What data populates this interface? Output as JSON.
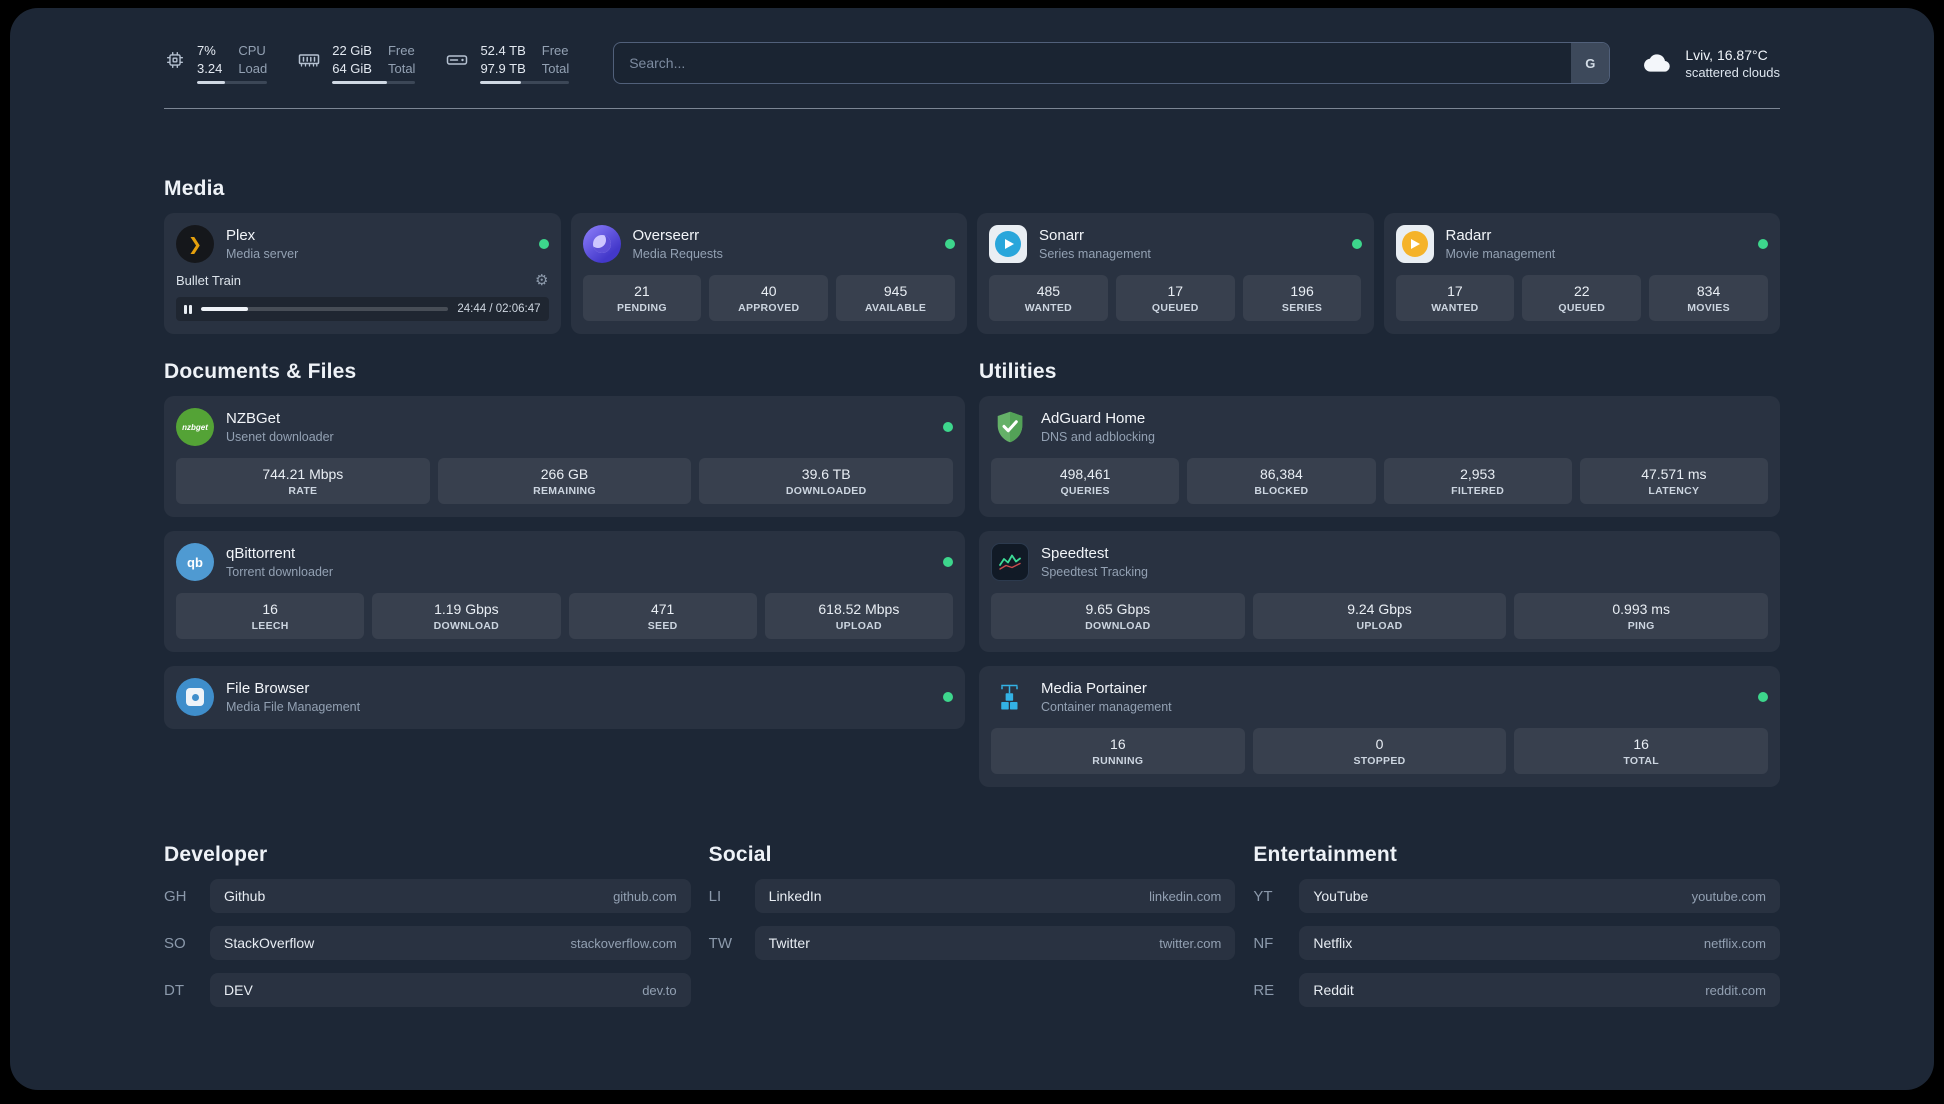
{
  "icons": {
    "plex_chevron": "❯",
    "gear": "⚙",
    "nzbget_label": "nzbget",
    "qbittorrent_label": "qb"
  },
  "colors": {
    "status_online": "#3dd68c",
    "portainer_blue": "#33b2e5"
  },
  "topbar": {
    "cpu": {
      "value_top": "7%",
      "value_bottom": "3.24",
      "label_top": "CPU",
      "label_bottom": "Load",
      "bar_percent": 40
    },
    "memory": {
      "value_top": "22 GiB",
      "value_bottom": "64 GiB",
      "label_top": "Free",
      "label_bottom": "Total",
      "bar_percent": 66
    },
    "disk": {
      "value_top": "52.4 TB",
      "value_bottom": "97.9 TB",
      "label_top": "Free",
      "label_bottom": "Total",
      "bar_percent": 46
    },
    "search": {
      "placeholder": "Search...",
      "provider_button": "G"
    },
    "weather": {
      "location": "Lviv, 16.87°C",
      "condition": "scattered clouds"
    }
  },
  "media": {
    "heading": "Media",
    "plex": {
      "title": "Plex",
      "subtitle": "Media server",
      "now_playing": "Bullet Train",
      "progress_percent": 19,
      "time": "24:44 / 02:06:47"
    },
    "overseerr": {
      "title": "Overseerr",
      "subtitle": "Media Requests",
      "stats": [
        {
          "value": "21",
          "label": "PENDING"
        },
        {
          "value": "40",
          "label": "APPROVED"
        },
        {
          "value": "945",
          "label": "AVAILABLE"
        }
      ]
    },
    "sonarr": {
      "title": "Sonarr",
      "subtitle": "Series management",
      "stats": [
        {
          "value": "485",
          "label": "WANTED"
        },
        {
          "value": "17",
          "label": "QUEUED"
        },
        {
          "value": "196",
          "label": "SERIES"
        }
      ]
    },
    "radarr": {
      "title": "Radarr",
      "subtitle": "Movie management",
      "stats": [
        {
          "value": "17",
          "label": "WANTED"
        },
        {
          "value": "22",
          "label": "QUEUED"
        },
        {
          "value": "834",
          "label": "MOVIES"
        }
      ]
    }
  },
  "documents": {
    "heading": "Documents & Files",
    "nzbget": {
      "title": "NZBGet",
      "subtitle": "Usenet downloader",
      "stats": [
        {
          "value": "744.21 Mbps",
          "label": "RATE"
        },
        {
          "value": "266 GB",
          "label": "REMAINING"
        },
        {
          "value": "39.6 TB",
          "label": "DOWNLOADED"
        }
      ]
    },
    "qbittorrent": {
      "title": "qBittorrent",
      "subtitle": "Torrent downloader",
      "stats": [
        {
          "value": "16",
          "label": "LEECH"
        },
        {
          "value": "1.19 Gbps",
          "label": "DOWNLOAD"
        },
        {
          "value": "471",
          "label": "SEED"
        },
        {
          "value": "618.52 Mbps",
          "label": "UPLOAD"
        }
      ]
    },
    "filebrowser": {
      "title": "File Browser",
      "subtitle": "Media File Management"
    }
  },
  "utilities": {
    "heading": "Utilities",
    "adguard": {
      "title": "AdGuard Home",
      "subtitle": "DNS and adblocking",
      "stats": [
        {
          "value": "498,461",
          "label": "QUERIES"
        },
        {
          "value": "86,384",
          "label": "BLOCKED"
        },
        {
          "value": "2,953",
          "label": "FILTERED"
        },
        {
          "value": "47.571 ms",
          "label": "LATENCY"
        }
      ]
    },
    "speedtest": {
      "title": "Speedtest",
      "subtitle": "Speedtest Tracking",
      "stats": [
        {
          "value": "9.65 Gbps",
          "label": "DOWNLOAD"
        },
        {
          "value": "9.24 Gbps",
          "label": "UPLOAD"
        },
        {
          "value": "0.993 ms",
          "label": "PING"
        }
      ]
    },
    "portainer": {
      "title": "Media Portainer",
      "subtitle": "Container management",
      "stats": [
        {
          "value": "16",
          "label": "RUNNING"
        },
        {
          "value": "0",
          "label": "STOPPED"
        },
        {
          "value": "16",
          "label": "TOTAL"
        }
      ]
    }
  },
  "bookmarks": {
    "developer": {
      "heading": "Developer",
      "items": [
        {
          "abbr": "GH",
          "name": "Github",
          "url": "github.com"
        },
        {
          "abbr": "SO",
          "name": "StackOverflow",
          "url": "stackoverflow.com"
        },
        {
          "abbr": "DT",
          "name": "DEV",
          "url": "dev.to"
        }
      ]
    },
    "social": {
      "heading": "Social",
      "items": [
        {
          "abbr": "LI",
          "name": "LinkedIn",
          "url": "linkedin.com"
        },
        {
          "abbr": "TW",
          "name": "Twitter",
          "url": "twitter.com"
        }
      ]
    },
    "entertainment": {
      "heading": "Entertainment",
      "items": [
        {
          "abbr": "YT",
          "name": "YouTube",
          "url": "youtube.com"
        },
        {
          "abbr": "NF",
          "name": "Netflix",
          "url": "netflix.com"
        },
        {
          "abbr": "RE",
          "name": "Reddit",
          "url": "reddit.com"
        }
      ]
    }
  }
}
